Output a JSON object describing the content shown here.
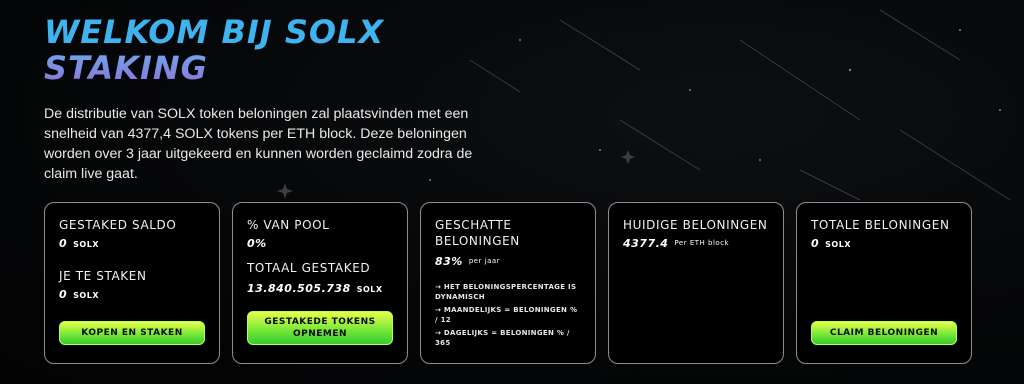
{
  "header": {
    "title_line1": "WELKOM BIJ SOLX",
    "title_line2": "STAKING",
    "intro": "De distributie van SOLX token beloningen zal plaatsvinden met een snelheid van 4377,4 SOLX tokens per ETH block. Deze beloningen worden over 3 jaar uitgekeerd en kunnen worden geclaimd zodra de claim live gaat."
  },
  "cards": {
    "staked": {
      "label1": "GESTAKED SALDO",
      "value1": "0",
      "unit1": "SOLX",
      "label2": "JE TE STAKEN",
      "value2": "0",
      "unit2": "SOLX",
      "button": "KOPEN EN STAKEN"
    },
    "pool": {
      "label1": "% VAN POOL",
      "value1": "0%",
      "label2": "TOTAAL GESTAKED",
      "value2": "13.840.505.738",
      "unit2": "SOLX",
      "button": "GESTAKEDE TOKENS OPNEMEN"
    },
    "rewards_est": {
      "label": "GESCHATTE BELONINGEN",
      "value": "83%",
      "suffix": "per jaar",
      "notes": [
        "→ HET BELONINGSPERCENTAGE IS DYNAMISCH",
        "→ MAANDELIJKS = BELONINGEN % / 12",
        "→ DAGELIJKS = BELONINGEN % / 365"
      ]
    },
    "current": {
      "label": "HUIDIGE BELONINGEN",
      "value": "4377.4",
      "suffix": "Per ETH block"
    },
    "total": {
      "label": "TOTALE BELONINGEN",
      "value": "0",
      "unit": "SOLX",
      "button": "CLAIM BELONINGEN"
    }
  },
  "colors": {
    "title_blue": "#3fb3f0",
    "title_purple": "#8a74d6",
    "button_green": "#6fe637",
    "card_border": "#8d8d8d"
  }
}
